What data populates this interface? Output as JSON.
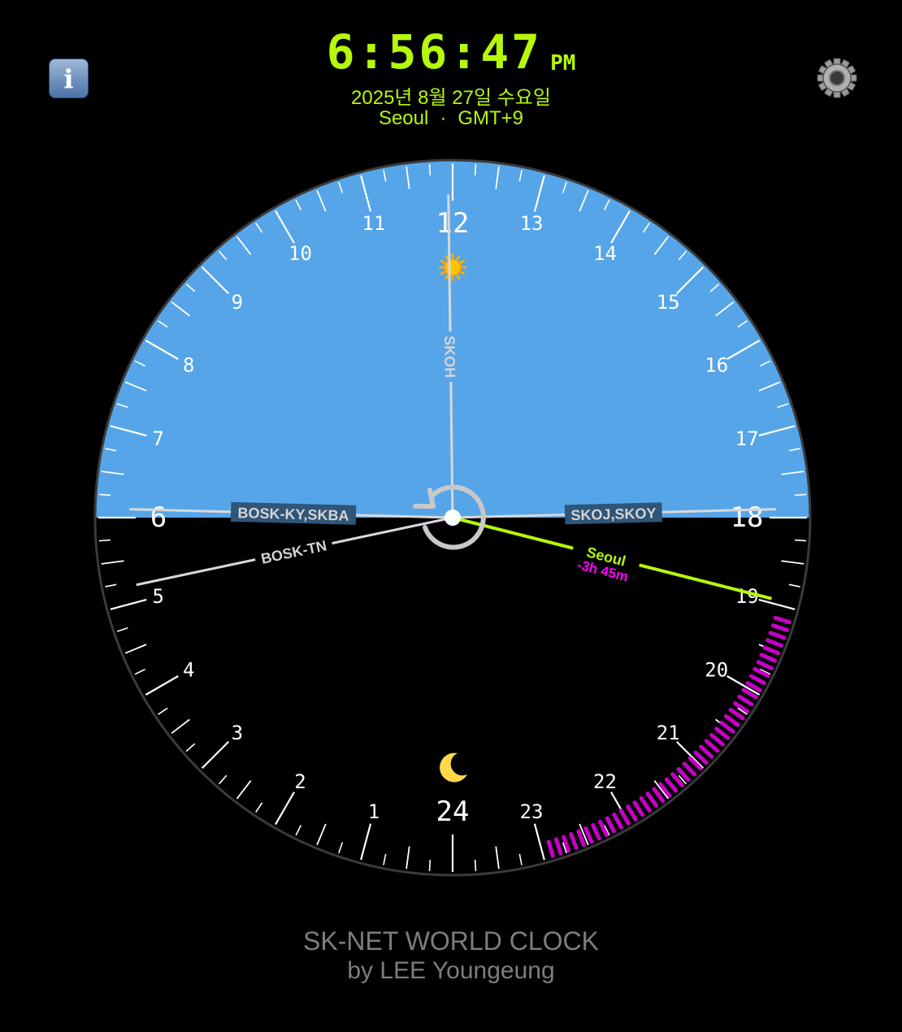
{
  "header": {
    "time": "6:56:47",
    "ampm": "PM",
    "date": "2025년 8월 27일 수요일",
    "city": "Seoul",
    "separator": "·",
    "timezone": "GMT+9"
  },
  "buttons": {
    "info_label": "i",
    "info_icon": "info-icon",
    "settings_icon": "gear-icon"
  },
  "dial": {
    "hour_labels": [
      "1",
      "2",
      "3",
      "4",
      "5",
      "6",
      "7",
      "8",
      "9",
      "10",
      "11",
      "12",
      "13",
      "14",
      "15",
      "16",
      "17",
      "18",
      "19",
      "20",
      "21",
      "22",
      "23",
      "24"
    ],
    "sun_icon": "sun-icon",
    "moon_icon": "moon-icon",
    "reset_icon": "counterclockwise-arrow-icon",
    "sunrise_hour": 6,
    "sunset_hour": 18,
    "day_color": "#56a5e8",
    "night_color": "#000000",
    "hands": [
      {
        "label": "SKOH",
        "hour": 11.95
      },
      {
        "label": "BOSK-KY,SKBA",
        "hour": 6.1
      },
      {
        "label": "SKOJ,SKOY",
        "hour": 17.9
      },
      {
        "label": "BOSK-TN",
        "hour": 5.2
      }
    ],
    "main_hand": {
      "city": "Seoul",
      "offset": "-3h 45m",
      "hour": 18.95,
      "color": "#b6f70b",
      "offset_color": "#ff00ff"
    },
    "countdown_arc": {
      "start_hour": 19.15,
      "end_hour": 22.9,
      "color": "#c800c8"
    }
  },
  "footer": {
    "title": "SK-NET WORLD CLOCK",
    "author": "by LEE Youngeung"
  }
}
